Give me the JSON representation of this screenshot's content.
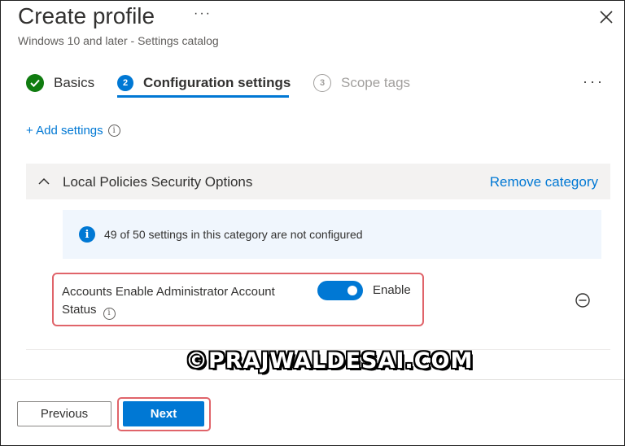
{
  "header": {
    "title": "Create profile",
    "more_label": "···",
    "subtitle": "Windows 10 and later - Settings catalog",
    "close_icon": "close-icon"
  },
  "steps": [
    {
      "label": "Basics",
      "status": "completed",
      "icon": "checkmark-icon"
    },
    {
      "label": "Configuration settings",
      "status": "current",
      "number": "2"
    },
    {
      "label": "Scope tags",
      "status": "upcoming",
      "number": "3"
    }
  ],
  "steps_more_label": "···",
  "add_settings_label": "+ Add settings",
  "category": {
    "title": "Local Policies Security Options",
    "remove_label": "Remove category",
    "info_text": "49 of 50 settings in this category are not configured",
    "info_icon_glyph": "i"
  },
  "setting": {
    "name": "Accounts Enable Administrator Account Status",
    "toggle_on": true,
    "toggle_label": "Enable",
    "info_glyph": "i"
  },
  "watermark": "©PRAJWALDESAI.COM",
  "footer": {
    "previous_label": "Previous",
    "next_label": "Next"
  },
  "colors": {
    "accent": "#0078d4",
    "success": "#107c10",
    "highlight": "#e0646a"
  }
}
